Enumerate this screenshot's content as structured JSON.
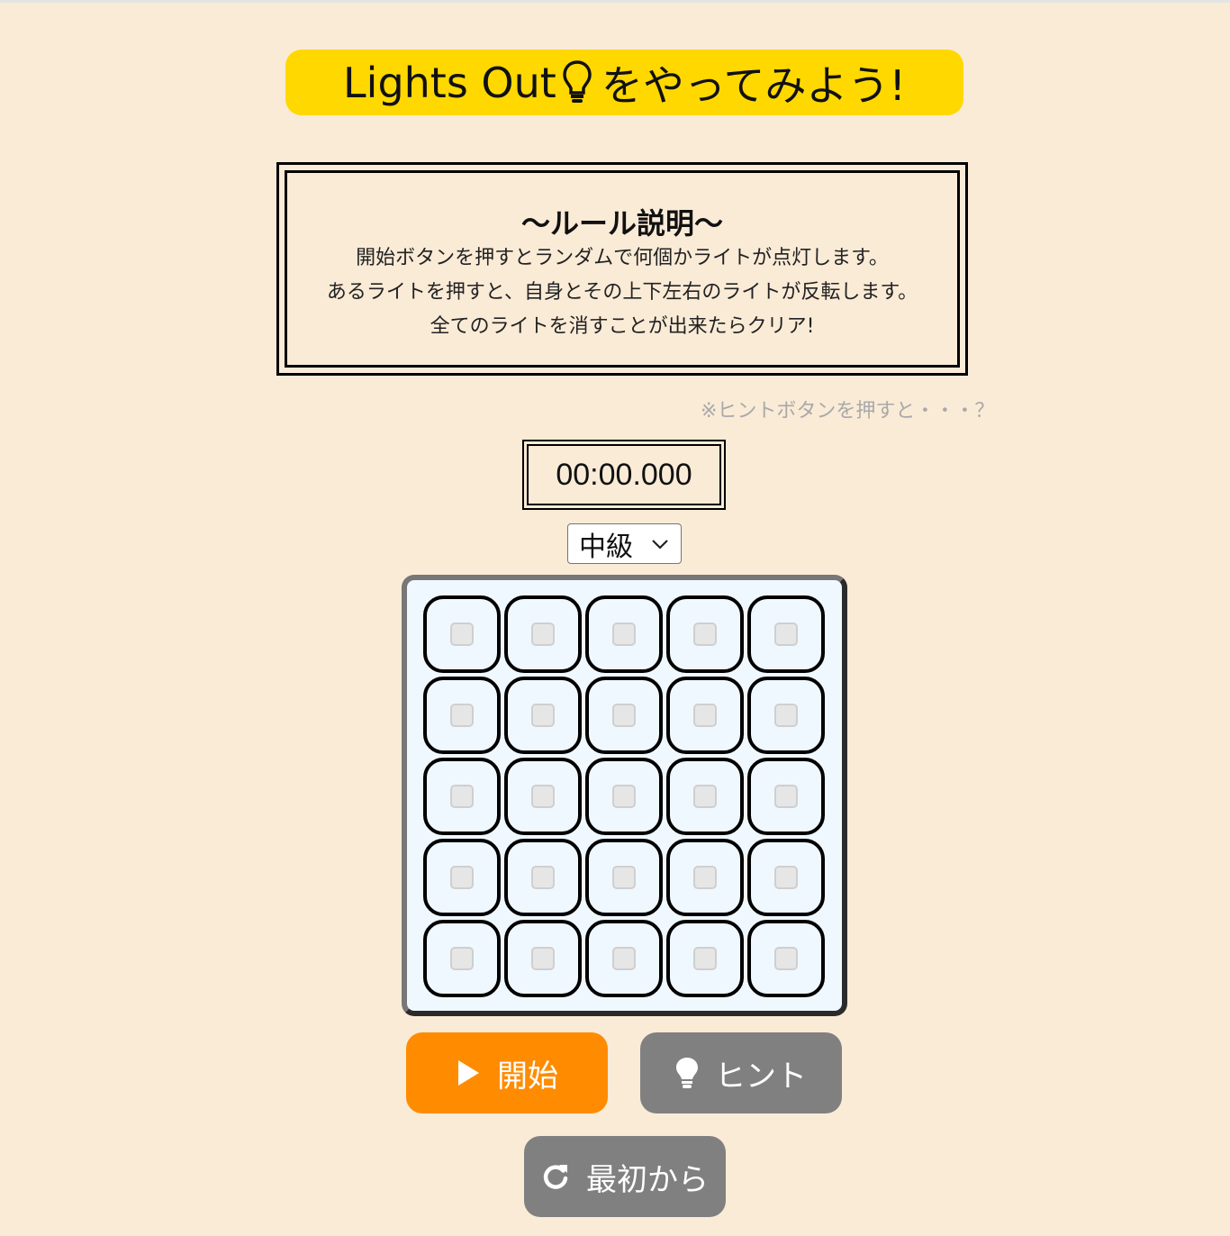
{
  "header": {
    "title_prefix": "Lights Out",
    "title_suffix": "をやってみよう!",
    "title_icon": "lightbulb-outline-icon"
  },
  "rules": {
    "heading": "～ルール説明～",
    "lines": [
      "開始ボタンを押すとランダムで何個かライトが点灯します。",
      "あるライトを押すと、自身とその上下左右のライトが反転します。",
      "全てのライトを消すことが出来たらクリア!"
    ]
  },
  "hint_note": "※ヒントボタンを押すと・・・？",
  "timer": "00:00.000",
  "level": {
    "selected": "中級"
  },
  "board": {
    "rows": 5,
    "cols": 5,
    "lights": [
      [
        0,
        0,
        0,
        0,
        0
      ],
      [
        0,
        0,
        0,
        0,
        0
      ],
      [
        0,
        0,
        0,
        0,
        0
      ],
      [
        0,
        0,
        0,
        0,
        0
      ],
      [
        0,
        0,
        0,
        0,
        0
      ]
    ]
  },
  "buttons": {
    "start": {
      "label": "開始",
      "icon": "play-icon"
    },
    "hint": {
      "label": "ヒント",
      "icon": "lightbulb-icon"
    },
    "reset": {
      "label": "最初から",
      "icon": "redo-icon"
    }
  },
  "colors": {
    "background": "#faebd7",
    "title_bg": "#ffd800",
    "start_button": "#ff8c00",
    "secondary_button": "#808080",
    "board_bg": "#f0f8ff"
  }
}
